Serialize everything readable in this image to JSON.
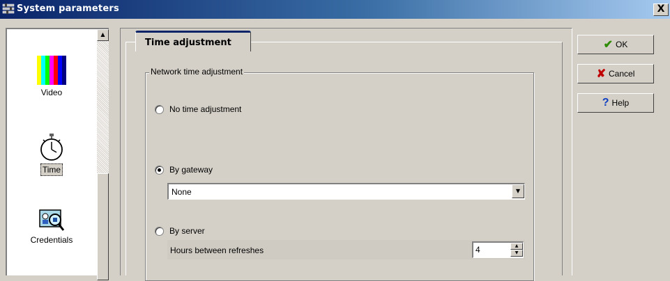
{
  "window": {
    "title": "System parameters",
    "close_label": "X"
  },
  "sidebar": {
    "items": [
      {
        "label": "Video",
        "icon": "color-bars-icon",
        "selected": false
      },
      {
        "label": "Time",
        "icon": "stopwatch-icon",
        "selected": true
      },
      {
        "label": "Credentials",
        "icon": "badge-magnifier-icon",
        "selected": false
      }
    ]
  },
  "tabs": [
    {
      "label": "Time adjustment",
      "active": true
    }
  ],
  "group": {
    "legend": "Network time adjustment",
    "options": [
      {
        "label": "No time adjustment",
        "checked": false
      },
      {
        "label": "By gateway",
        "checked": true
      },
      {
        "label": "By server",
        "checked": false
      }
    ],
    "gateway_select": {
      "value": "None"
    },
    "refresh": {
      "label": "Hours between refreshes",
      "value": "4"
    }
  },
  "buttons": {
    "ok": "OK",
    "cancel": "Cancel",
    "help": "Help"
  },
  "colors": {
    "ok_check": "#2e8b00",
    "cancel_x": "#c00000",
    "help_q": "#1040c0"
  }
}
